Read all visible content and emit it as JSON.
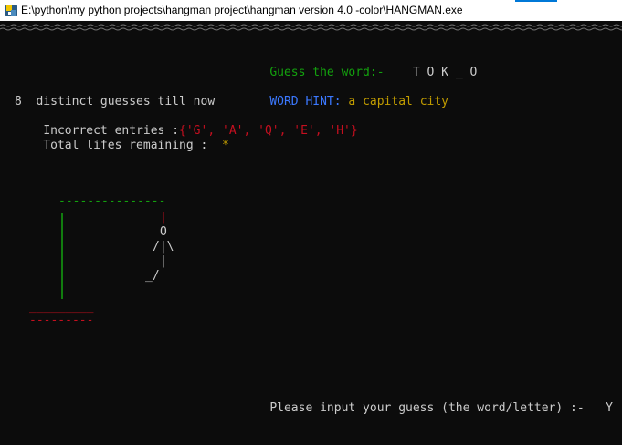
{
  "window": {
    "title": "E:\\python\\my python projects\\hangman project\\hangman version 4.0 -color\\HANGMAN.exe"
  },
  "game": {
    "guess_label": "Guess the word:-",
    "word_display": "T O K _ O",
    "hint_label": "WORD HINT:",
    "hint_value": "a capital city",
    "guess_count_text": "8  distinct guesses till now",
    "incorrect_label": "Incorrect entries :",
    "incorrect_value": "{'G', 'A', 'Q', 'E', 'H'}",
    "lives_label": "Total lifes remaining :",
    "lives_value": "*",
    "input_prompt": "Please input your guess (the word/letter) :-",
    "input_value": "Y"
  },
  "hangman": {
    "top_bar": "---------------",
    "rope": "|",
    "head": "O",
    "arms": "/|\\",
    "torso": "|",
    "legs": "_/",
    "base_top": "_________",
    "base_bottom": "---------"
  },
  "colors": {
    "green": "#13a10e",
    "blue": "#3b78ff",
    "yellow": "#c19c00",
    "red": "#c50f1f",
    "text": "#cccccc",
    "background": "#0c0c0c"
  }
}
